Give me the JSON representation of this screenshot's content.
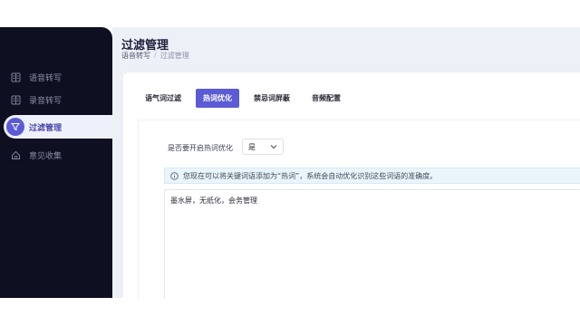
{
  "sidebar": {
    "items": [
      {
        "label": "语音转写",
        "icon": "document-icon"
      },
      {
        "label": "录音转写",
        "icon": "document-icon"
      },
      {
        "label": "过滤管理",
        "icon": "filter-icon",
        "active": true
      },
      {
        "label": "意见收集",
        "icon": "home-icon"
      }
    ]
  },
  "header": {
    "title": "过滤管理",
    "breadcrumb": [
      "语音转写",
      "/",
      "过滤管理"
    ]
  },
  "tabs": [
    {
      "label": "语气词过滤"
    },
    {
      "label": "热词优化",
      "active": true
    },
    {
      "label": "禁忌词屏蔽"
    },
    {
      "label": "音频配置"
    }
  ],
  "form": {
    "enable_label": "是否要开启热词优化",
    "enable_value": "是",
    "info_text": "您现在可以将关键词语添加为“热词”，系统会自动优化识别这些词语的准确度。",
    "hotwords": "墨水屏，无纸化，会务管理"
  },
  "colors": {
    "accent": "#5b5bd6",
    "sidebar_bg": "#0f0f22",
    "main_bg": "#eef0f8"
  }
}
